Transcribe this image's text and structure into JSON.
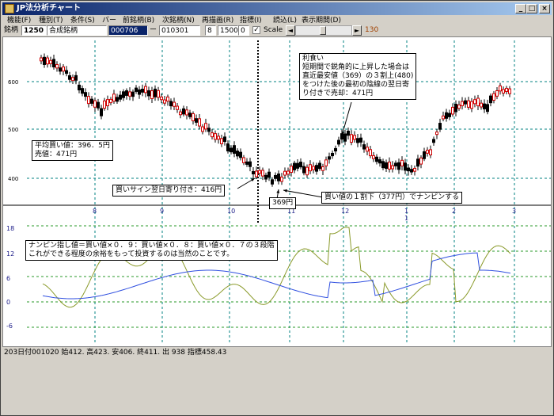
{
  "window": {
    "title": "JP法分析チャート",
    "minimize": "_",
    "maximize": "□",
    "close": "×"
  },
  "menu": [
    "機能(F)",
    "種別(T)",
    "条件(S)",
    "バー",
    "前銘柄(B)",
    "次銘柄(N)",
    "再描画(R)",
    "指標(I)",
    "読込(L)",
    "表示期間(D)"
  ],
  "toolbar": {
    "label": "銘柄",
    "code": "1250",
    "name": "合成銘柄",
    "date_from": "000706",
    "dash": "ー",
    "date_to": "010301",
    "v1": "8",
    "v2": "1500",
    "v3": "0",
    "check": "✓",
    "scale_label": "Scale",
    "left_arrow": "◄",
    "right_arrow": "►",
    "extra": "130"
  },
  "price_axis": {
    "ticks": [
      "600",
      "500",
      "400"
    ]
  },
  "x_axis": {
    "ticks": [
      "8",
      "9",
      "10",
      "11",
      "12",
      "1",
      "2",
      "3"
    ],
    "year_mark": "1"
  },
  "osc_axis": {
    "ticks": [
      "18",
      "12",
      "6",
      "0",
      "-6"
    ]
  },
  "annotations": {
    "avg": [
      "平均買い値：396．5円",
      "売値：471円"
    ],
    "buy": "買いサイン翌日寄り付き：416円",
    "low": "369円",
    "nanpin": "買い値の１割下（377円）でナンピンする",
    "profit": [
      "利食い",
      "短期間で鋭角的に上昇した場合は",
      "直近最安値（369）の３割上(480)",
      "をつけた後の最初の陰線の翌日寄",
      "り付きで売却：471円"
    ],
    "osc": [
      "ナンピン指し値＝買い値×０．９：買い値×０．８：買い値×０．７の３段階",
      "これができる程度の余裕をもって投資するのは当然のことです。"
    ]
  },
  "status": "203日付001020 始412. 高423. 安406. 終411. 出 938 指標458.43",
  "colors": {
    "candle_up": "#d00000",
    "candle_down": "#000000",
    "grid": "#008080",
    "osc_line": "#8a9a2a",
    "ma_line": "#3050e0"
  }
}
